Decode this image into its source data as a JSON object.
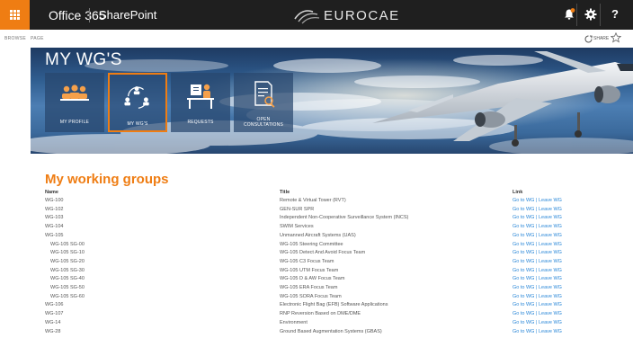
{
  "suite_bar": {
    "app_name": "Office 365",
    "site_name": "SharePoint",
    "logo_text": "EUROCAE",
    "settings_icon": "gear-icon",
    "help_label": "?"
  },
  "ribbon": {
    "tabs": [
      "BROWSE",
      "PAGE"
    ],
    "share_label": "SHARE"
  },
  "hero": {
    "title": "MY WG'S",
    "tiles": [
      {
        "label": "MY PROFILE",
        "icon": "people-icon"
      },
      {
        "label": "MY WG'S",
        "icon": "network-icon"
      },
      {
        "label": "REQUESTS",
        "icon": "desk-worker-icon"
      },
      {
        "label_line1": "OPEN",
        "label_line2": "CONSULTATIONS",
        "icon": "document-search-icon"
      }
    ]
  },
  "working_groups": {
    "heading": "My working groups",
    "columns": {
      "name": "Name",
      "title": "Title",
      "link": "Link"
    },
    "link_go": "Go to WG",
    "link_sep": " | ",
    "link_leave": "Leave WG",
    "rows": [
      {
        "name": "WG-100",
        "title": "Remote & Virtual Tower (RVT)",
        "indent": false
      },
      {
        "name": "WG-102",
        "title": "GEN-SUR SPR",
        "indent": false
      },
      {
        "name": "WG-103",
        "title": "Independent Non-Cooperative Surveillance System (INCS)",
        "indent": false
      },
      {
        "name": "WG-104",
        "title": "SWIM Services",
        "indent": false
      },
      {
        "name": "WG-105",
        "title": "Unmanned Aircraft Systems (UAS)",
        "indent": false
      },
      {
        "name": "WG-105 SG-00",
        "title": "WG-105 Steering Committee",
        "indent": true
      },
      {
        "name": "WG-105 SG-10",
        "title": "WG-105 Detect And Avoid Focus Team",
        "indent": true
      },
      {
        "name": "WG-105 SG-20",
        "title": "WG-105 C3 Focus Team",
        "indent": true
      },
      {
        "name": "WG-105 SG-30",
        "title": "WG-105 UTM Focus Team",
        "indent": true
      },
      {
        "name": "WG-105 SG-40",
        "title": "WG-105 D & AW Focus Team",
        "indent": true
      },
      {
        "name": "WG-105 SG-50",
        "title": "WG-105 ERA Focus Team",
        "indent": true
      },
      {
        "name": "WG-105 SG-60",
        "title": "WG-105 SORA Focus Team",
        "indent": true
      },
      {
        "name": "WG-106",
        "title": "Electronic Flight Bag (EFB) Software Applications",
        "indent": false
      },
      {
        "name": "WG-107",
        "title": "RNP Reversion Based on DME/DME",
        "indent": false
      },
      {
        "name": "WG-14",
        "title": "Environment",
        "indent": false
      },
      {
        "name": "WG-28",
        "title": "Ground Based Augmentation Systems (GBAS)",
        "indent": false
      }
    ]
  },
  "colors": {
    "accent": "#ef7d13",
    "suite_bar": "#1f1f1f",
    "link": "#2b88d8"
  }
}
